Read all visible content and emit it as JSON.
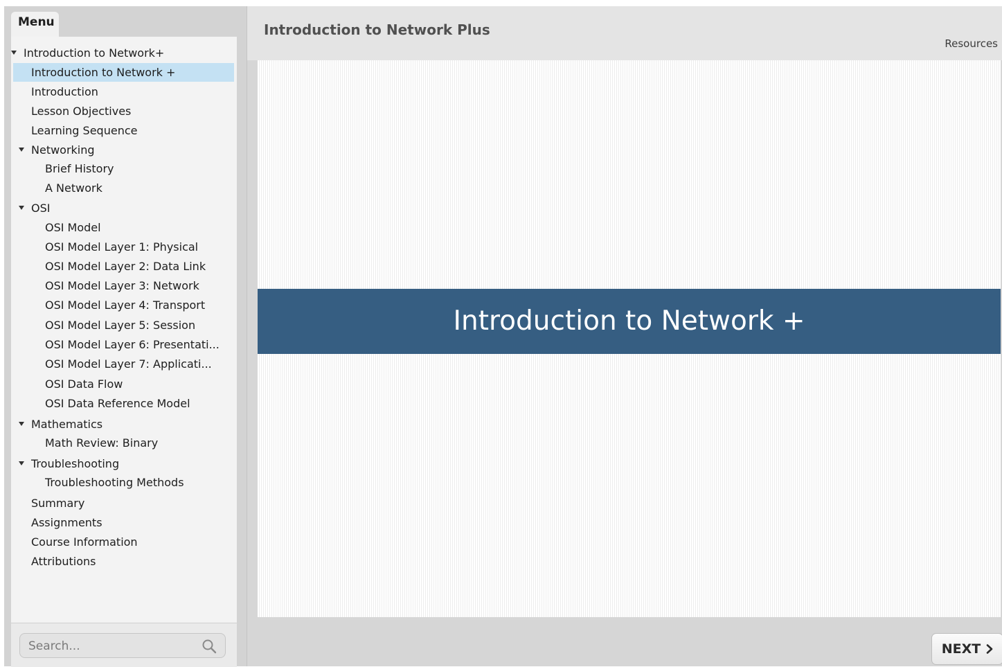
{
  "sidebar": {
    "menu_tab_label": "Menu",
    "items": [
      {
        "label": "Introduction to Network+",
        "level": 0,
        "expandable": true,
        "selected": false
      },
      {
        "label": "Introduction to Network +",
        "level": 1,
        "expandable": false,
        "selected": true
      },
      {
        "label": "Introduction",
        "level": 1,
        "expandable": false,
        "selected": false
      },
      {
        "label": "Lesson Objectives",
        "level": 1,
        "expandable": false,
        "selected": false
      },
      {
        "label": "Learning Sequence",
        "level": 1,
        "expandable": false,
        "selected": false
      },
      {
        "label": "Networking",
        "level": 1,
        "expandable": true,
        "selected": false
      },
      {
        "label": "Brief History",
        "level": 2,
        "expandable": false,
        "selected": false
      },
      {
        "label": "A Network",
        "level": 2,
        "expandable": false,
        "selected": false
      },
      {
        "label": "OSI",
        "level": 1,
        "expandable": true,
        "selected": false
      },
      {
        "label": "OSI Model",
        "level": 2,
        "expandable": false,
        "selected": false
      },
      {
        "label": "OSI Model Layer 1: Physical",
        "level": 2,
        "expandable": false,
        "selected": false
      },
      {
        "label": "OSI Model Layer 2: Data Link",
        "level": 2,
        "expandable": false,
        "selected": false
      },
      {
        "label": "OSI Model Layer 3: Network",
        "level": 2,
        "expandable": false,
        "selected": false
      },
      {
        "label": "OSI Model Layer 4: Transport",
        "level": 2,
        "expandable": false,
        "selected": false
      },
      {
        "label": "OSI Model Layer 5:  Session",
        "level": 2,
        "expandable": false,
        "selected": false
      },
      {
        "label": "OSI Model Layer 6: Presentati...",
        "level": 2,
        "expandable": false,
        "selected": false
      },
      {
        "label": "OSI Model Layer 7:  Applicati...",
        "level": 2,
        "expandable": false,
        "selected": false
      },
      {
        "label": "OSI Data Flow",
        "level": 2,
        "expandable": false,
        "selected": false
      },
      {
        "label": "OSI Data Reference Model",
        "level": 2,
        "expandable": false,
        "selected": false
      },
      {
        "label": "Mathematics",
        "level": 1,
        "expandable": true,
        "selected": false
      },
      {
        "label": "Math Review: Binary",
        "level": 2,
        "expandable": false,
        "selected": false
      },
      {
        "label": "Troubleshooting",
        "level": 1,
        "expandable": true,
        "selected": false
      },
      {
        "label": "Troubleshooting Methods",
        "level": 2,
        "expandable": false,
        "selected": false
      },
      {
        "label": "Summary",
        "level": 1,
        "expandable": false,
        "selected": false
      },
      {
        "label": "Assignments",
        "level": 1,
        "expandable": false,
        "selected": false
      },
      {
        "label": "Course Information",
        "level": 1,
        "expandable": false,
        "selected": false
      },
      {
        "label": "Attributions",
        "level": 1,
        "expandable": false,
        "selected": false
      }
    ],
    "search": {
      "placeholder": "Search...",
      "value": "",
      "icon": "search-icon"
    }
  },
  "header": {
    "title": "Introduction to Network Plus",
    "resources_label": "Resources"
  },
  "slide": {
    "banner_text": "Introduction to Network +",
    "banner_color": "#365e82"
  },
  "footer": {
    "next_label": "NEXT",
    "next_icon": "chevron-right-icon"
  },
  "colors": {
    "selected_item_bg": "#c4e1f3",
    "sidebar_bg": "#d3d3d3",
    "menu_panel_bg": "#f3f3f3"
  }
}
